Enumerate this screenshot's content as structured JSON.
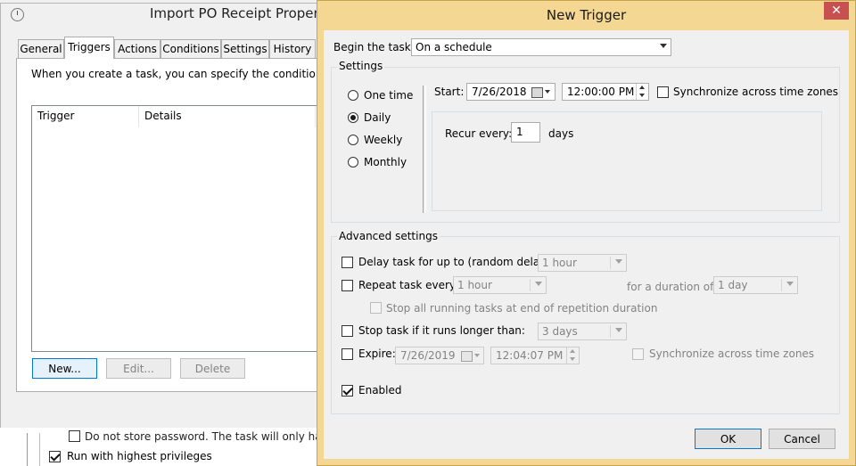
{
  "props_window": {
    "title": "Import PO Receipt Properties",
    "tabs": [
      "General",
      "Triggers",
      "Actions",
      "Conditions",
      "Settings",
      "History"
    ],
    "active_tab": "Triggers",
    "intro_text": "When you create a task, you can specify the conditions that w",
    "columns": [
      "Trigger",
      "Details"
    ],
    "buttons": {
      "new": "New...",
      "edit": "Edit...",
      "delete": "Delete"
    },
    "dont_store_text": "Do not store password.  The task will only have ac",
    "run_highest": "Run with highest privileges"
  },
  "dialog": {
    "title": "New Trigger",
    "close_glyph": "✕",
    "begin_label": "Begin the task:",
    "begin_value": "On a schedule",
    "settings_label": "Settings",
    "schedule_options": [
      "One time",
      "Daily",
      "Weekly",
      "Monthly"
    ],
    "selected_schedule": "Daily",
    "start_label": "Start:",
    "start_date": "7/26/2018",
    "start_time": "12:00:00 PM",
    "sync_label": "Synchronize across time zones",
    "recur_label": "Recur every:",
    "recur_value": "1",
    "recur_unit": "days",
    "advanced_label": "Advanced settings",
    "delay_label": "Delay task for up to (random delay):",
    "delay_value": "1 hour",
    "repeat_label": "Repeat task every:",
    "repeat_value": "1 hour",
    "duration_label": "for a duration of:",
    "duration_value": "1 day",
    "stop_running_label": "Stop all running tasks at end of repetition duration",
    "stop_longer_label": "Stop task if it runs longer than:",
    "stop_longer_value": "3 days",
    "expire_label": "Expire:",
    "expire_date": "7/26/2019",
    "expire_time": "12:04:07 PM",
    "expire_sync_label": "Synchronize across time zones",
    "enabled_label": "Enabled",
    "ok": "OK",
    "cancel": "Cancel"
  },
  "colors": {
    "dialog_frame": "#f5d794",
    "close_button": "#c75050",
    "focus_blue": "#0078d7"
  }
}
